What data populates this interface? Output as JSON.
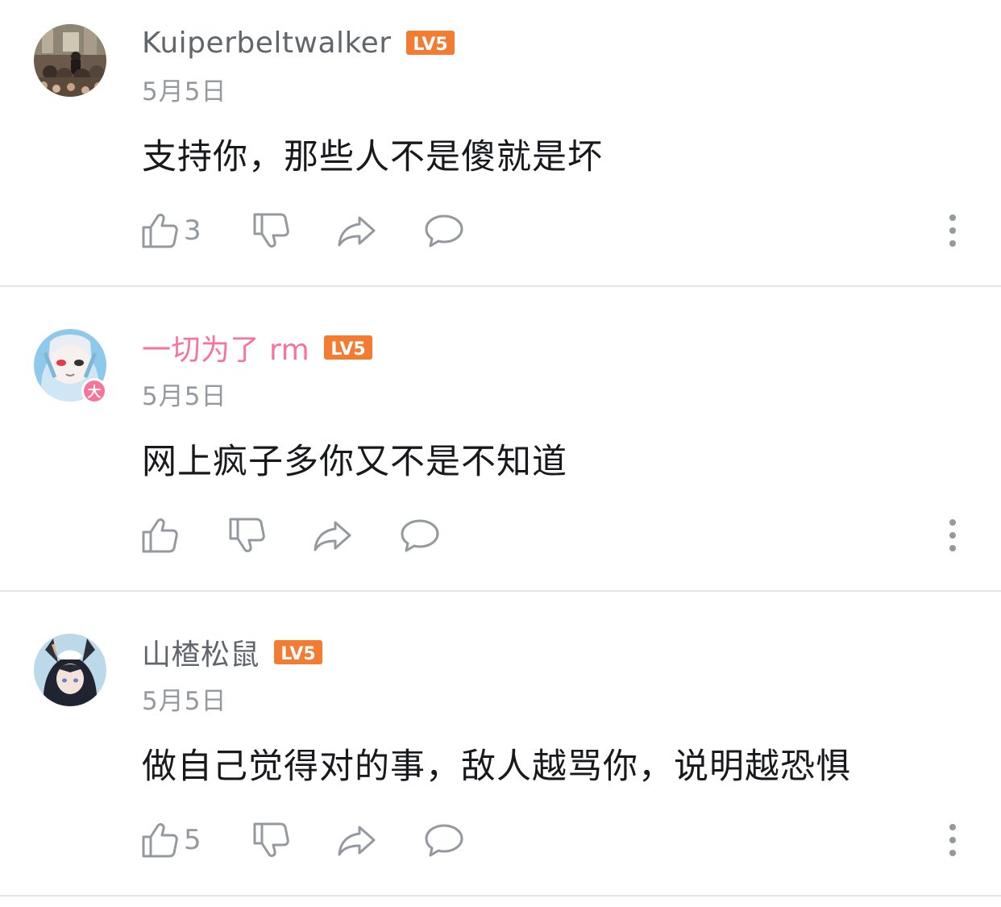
{
  "comments": [
    {
      "username": "Kuiperbeltwalker",
      "level": "LV5",
      "date": "5月5日",
      "text": "支持你，那些人不是傻就是坏",
      "like_count": "3",
      "username_color": "#61666d"
    },
    {
      "username": "一切为了 rm",
      "level": "LV5",
      "date": "5月5日",
      "text": "网上疯子多你又不是不知道",
      "like_count": "",
      "avatar_badge": "大",
      "username_color": "#fb7299"
    },
    {
      "username": "山楂松鼠",
      "level": "LV5",
      "date": "5月5日",
      "text": "做自己觉得对的事，敌人越骂你，说明越恐惧",
      "like_count": "5",
      "username_color": "#61666d"
    }
  ],
  "colors": {
    "level_badge": "#f37c33",
    "pink_accent": "#fb7299",
    "icon_gray": "#9499a0",
    "divider": "#e3e5e7"
  },
  "icons": [
    "thumbs-up-icon",
    "thumbs-down-icon",
    "share-icon",
    "reply-icon",
    "more-vertical-icon"
  ]
}
